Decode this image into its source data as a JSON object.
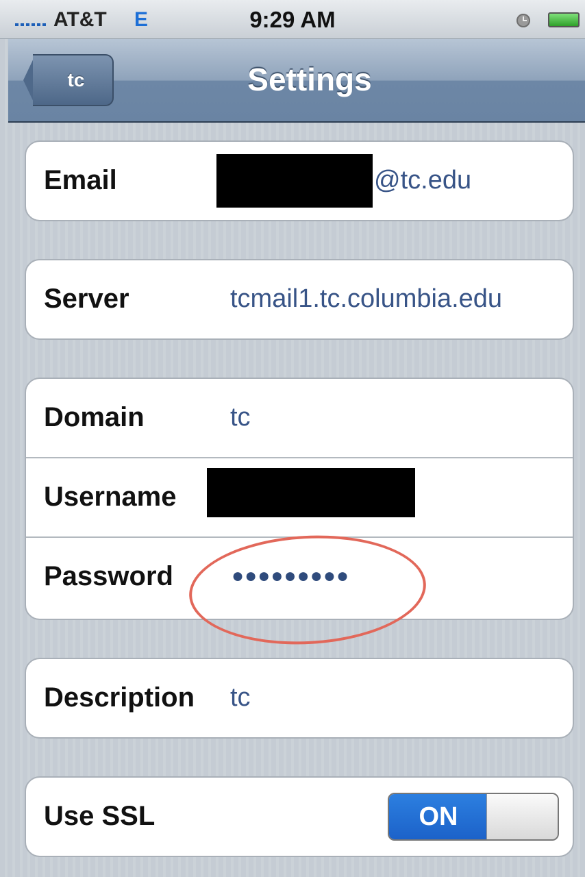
{
  "status_bar": {
    "carrier": "AT&T",
    "network": "E",
    "time": "9:29 AM"
  },
  "nav": {
    "back_label": "tc",
    "title": "Settings"
  },
  "fields": {
    "email": {
      "label": "Email",
      "value_suffix": "@tc.edu"
    },
    "server": {
      "label": "Server",
      "value": "tcmail1.tc.columbia.edu"
    },
    "domain": {
      "label": "Domain",
      "value": "tc"
    },
    "username": {
      "label": "Username"
    },
    "password": {
      "label": "Password",
      "masked_value": "●●●●●●●●●"
    },
    "description": {
      "label": "Description",
      "value": "tc"
    },
    "use_ssl": {
      "label": "Use SSL",
      "toggle_text": "ON",
      "state": true
    }
  },
  "colors": {
    "value_text": "#385487",
    "annotation_ring": "#e2685a",
    "toggle_on": "#1c62c9"
  }
}
